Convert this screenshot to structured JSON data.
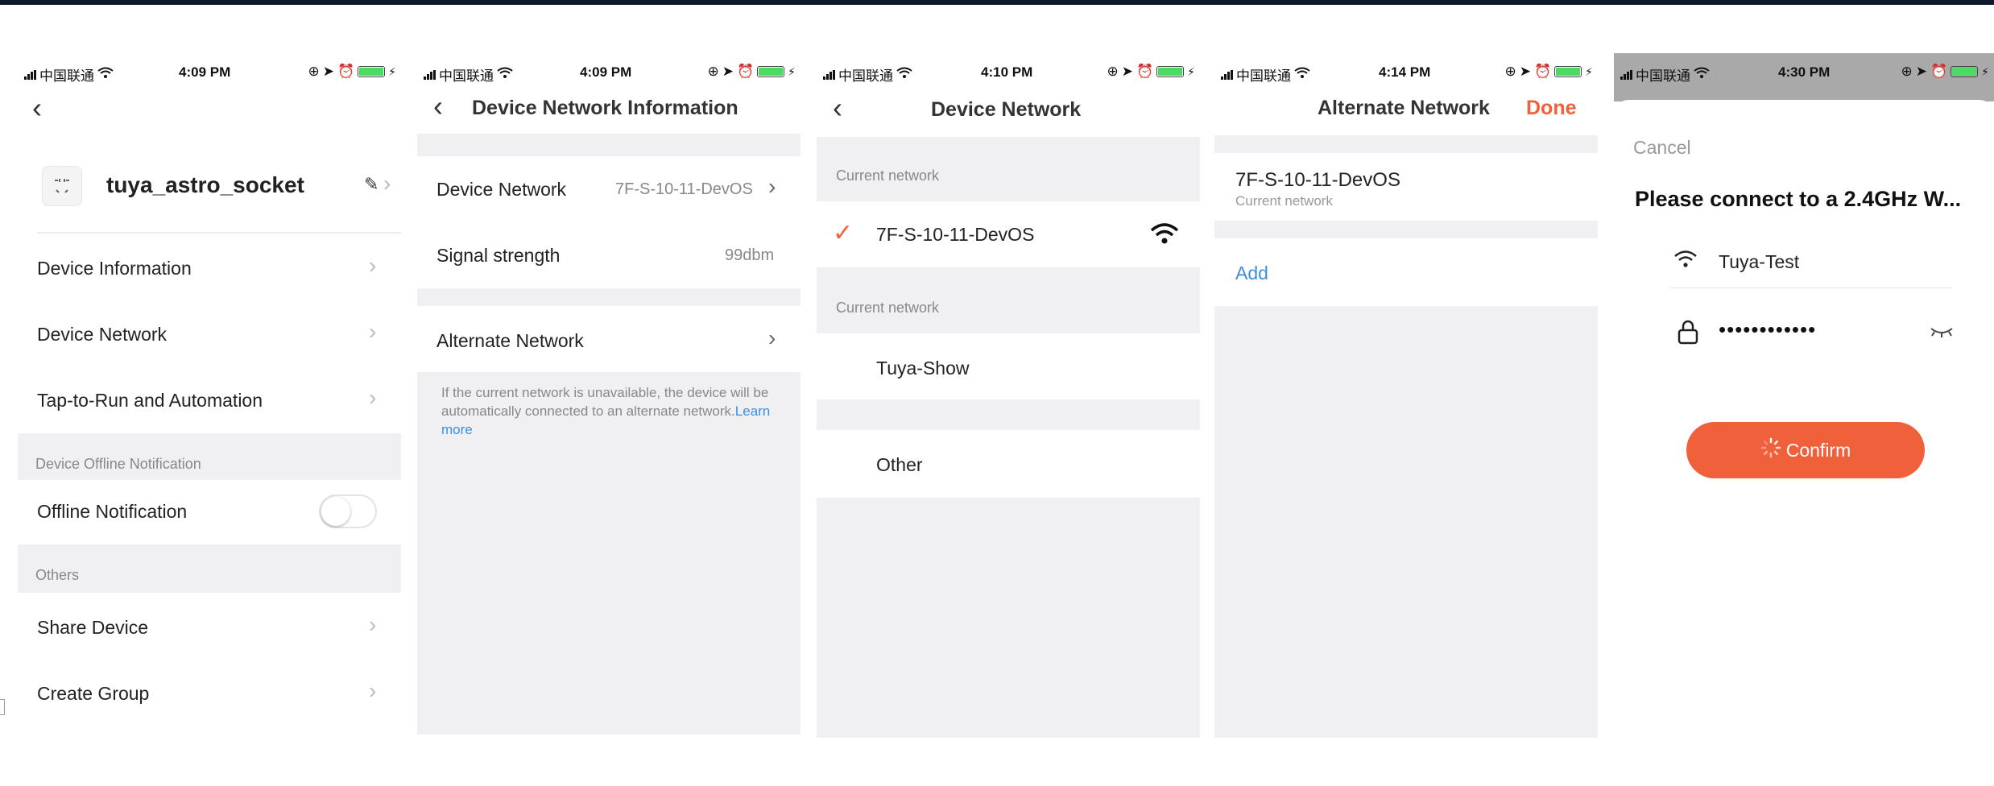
{
  "status_bar": [
    {
      "carrier": "中国联通",
      "time": "4:09 PM"
    },
    {
      "carrier": "中国联通",
      "time": "4:09 PM"
    },
    {
      "carrier": "中国联通",
      "time": "4:10 PM"
    },
    {
      "carrier": "中国联通",
      "time": "4:14 PM"
    },
    {
      "carrier": "中国联通",
      "time": "4:30 PM"
    }
  ],
  "device_settings": {
    "device_name": "tuya_astro_socket",
    "items": [
      {
        "label": "Device Information"
      },
      {
        "label": "Device Network"
      },
      {
        "label": "Tap-to-Run and Automation"
      }
    ],
    "offline_section": "Device Offline Notification",
    "offline_label": "Offline Notification",
    "offline_enabled": false,
    "others_section": "Others",
    "others_items": [
      {
        "label": "Share Device"
      },
      {
        "label": "Create Group"
      }
    ]
  },
  "network_info": {
    "title": "Device Network Information",
    "device_network_label": "Device Network",
    "device_network_value": "7F-S-10-11-DevOS",
    "signal_label": "Signal strength",
    "signal_value": "99dbm",
    "alternate_label": "Alternate Network",
    "note": "If the current network is unavailable, the device will be automatically connected to an alternate network.",
    "learn_more": "Learn more"
  },
  "device_network": {
    "title": "Device Network",
    "section_1": "Current network",
    "current_network": "7F-S-10-11-DevOS",
    "section_2": "Current network",
    "alt_network": "Tuya-Show",
    "other": "Other"
  },
  "alternate_network": {
    "title": "Alternate Network",
    "done": "Done",
    "network_name": "7F-S-10-11-DevOS",
    "network_sub": "Current network",
    "add": "Add"
  },
  "wifi_dialog": {
    "cancel": "Cancel",
    "heading": "Please connect to a 2.4GHz W...",
    "ssid": "Tuya-Test",
    "password": "••••••••••••",
    "confirm": "Confirm"
  },
  "colors": {
    "accent": "#f0603a",
    "link": "#3b8fe0",
    "check": "#f0603a",
    "battery": "#4cd964",
    "section_bg": "#f0f0f2"
  }
}
